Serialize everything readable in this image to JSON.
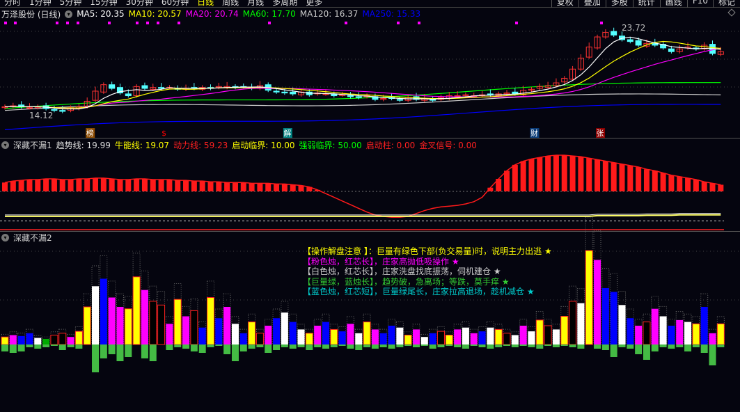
{
  "menu": {
    "tabs": [
      "分时",
      "1分钟",
      "5分钟",
      "15分钟",
      "30分钟",
      "60分钟",
      "日线",
      "周线",
      "月线",
      "多周期",
      "更多"
    ],
    "active": "日线",
    "right_buttons": [
      "复权",
      "叠加",
      "多股",
      "统计",
      "画线",
      "F10",
      "标记"
    ]
  },
  "main_header": {
    "stock": "万泽股份 (日线)",
    "ma": [
      {
        "label": "MA5: 20.35",
        "color": "#ffffff"
      },
      {
        "label": "MA10: 20.57",
        "color": "#ffff00"
      },
      {
        "label": "MA20: 20.74",
        "color": "#ff00ff"
      },
      {
        "label": "MA60: 17.70",
        "color": "#00ff00"
      },
      {
        "label": "MA120: 16.37",
        "color": "#cccccc"
      },
      {
        "label": "MA250: 15.33",
        "color": "#0000ff"
      }
    ]
  },
  "price_labels": {
    "high": "23.72",
    "low": "14.12"
  },
  "event_markers": [
    {
      "text": "榜",
      "index": 10,
      "color": "#8b4a00"
    },
    {
      "text": "$",
      "index": 19,
      "color": "#ff0000"
    },
    {
      "text": "解",
      "index": 34,
      "color": "#008080"
    },
    {
      "text": "财",
      "index": 64,
      "color": "#0a3c78"
    },
    {
      "text": "张",
      "index": 72,
      "color": "#8b0000"
    }
  ],
  "ind1_header": {
    "name": "深藏不漏1",
    "items": [
      {
        "label": "趋势线: 19.99",
        "color": "#dddddd"
      },
      {
        "label": "牛能线: 19.07",
        "color": "#ffff00"
      },
      {
        "label": "动力线: 59.23",
        "color": "#ff2020"
      },
      {
        "label": "启动临界: 10.00",
        "color": "#ffff00"
      },
      {
        "label": "强弱临界: 50.00",
        "color": "#00ff00"
      },
      {
        "label": "启动柱: 0.00",
        "color": "#ff2020"
      },
      {
        "label": "金叉信号: 0.00",
        "color": "#ff2020"
      }
    ]
  },
  "ind2_header": {
    "name": "深藏不漏2"
  },
  "legend": [
    {
      "text": "【操作解盘注意 】：巨量有绿色下部(负交易量)时，说明主力出逃 ★",
      "color": "#ffff00"
    },
    {
      "text": "【粉色烛，红芯长】，庄家高抛低吸操作 ★",
      "color": "#ff00ff"
    },
    {
      "text": "【白色烛，红芯长】，庄家洗盘找底振荡，伺机建仓 ★",
      "color": "#cccccc"
    },
    {
      "text": "【巨量绿，蓝烛长】，趋势破，急离场；等跌，莫手痒 ★",
      "color": "#33cc33"
    },
    {
      "text": "【蓝色烛，红芯短】，巨量绿尾长，庄家拉高退场，趁机减仓 ★",
      "color": "#00cccc"
    }
  ],
  "chart_data": {
    "type": "candlestick",
    "closes": [
      15.0,
      15.1,
      15.0,
      14.9,
      15.0,
      14.8,
      14.6,
      14.5,
      14.9,
      15.0,
      15.6,
      16.7,
      17.4,
      17.0,
      16.5,
      16.2,
      17.2,
      17.0,
      17.1,
      17.0,
      17.1,
      16.9,
      17.0,
      17.0,
      17.1,
      17.0,
      17.2,
      17.2,
      17.1,
      17.2,
      17.0,
      17.3,
      16.8,
      16.6,
      16.5,
      16.4,
      16.6,
      16.3,
      16.5,
      16.4,
      16.2,
      16.3,
      16.1,
      16.0,
      16.2,
      15.8,
      15.9,
      15.9,
      15.7,
      16.0,
      15.8,
      15.9,
      15.7,
      16.0,
      16.2,
      16.2,
      16.3,
      16.2,
      16.3,
      16.3,
      16.4,
      16.5,
      16.4,
      16.8,
      16.9,
      17.2,
      17.3,
      17.6,
      18.1,
      19.1,
      20.3,
      21.5,
      22.6,
      23.1,
      22.8,
      22.3,
      22.1,
      21.7,
      21.9,
      21.7,
      21.4,
      21.0,
      21.3,
      21.5,
      21.3,
      21.7,
      20.8,
      21.0
    ],
    "ma60_range": [
      14.8,
      17.7
    ],
    "ma120_range": [
      14.6,
      16.37
    ],
    "ma250_range": [
      12.5,
      15.33
    ],
    "price_range": [
      12.0,
      24.0
    ],
    "momentum": [
      62,
      64,
      65,
      66,
      66,
      67,
      67,
      66,
      66,
      67,
      67,
      68,
      68,
      67,
      66,
      66,
      67,
      67,
      66,
      66,
      66,
      65,
      65,
      64,
      64,
      63,
      63,
      62,
      62,
      62,
      61,
      61,
      61,
      60,
      60,
      59,
      58,
      56,
      52,
      47,
      42,
      37,
      32,
      27,
      22,
      18,
      16,
      15,
      15,
      16,
      20,
      24,
      27,
      29,
      30,
      31,
      33,
      36,
      42,
      55,
      67,
      78,
      86,
      91,
      94,
      96,
      98,
      99,
      99,
      98,
      97,
      95,
      93,
      91,
      89,
      87,
      85,
      83,
      80,
      78,
      75,
      72,
      70,
      68,
      66,
      63,
      61,
      59
    ],
    "trend_line": [
      18,
      18,
      18,
      18,
      18,
      18,
      18,
      18,
      18,
      18,
      18,
      18,
      18,
      18,
      18,
      18,
      18,
      18,
      18,
      18,
      18,
      18,
      18,
      18,
      18,
      18,
      18,
      18,
      18,
      18,
      18,
      18,
      18,
      18,
      18,
      18,
      18,
      18,
      18,
      18,
      18,
      18,
      18,
      18,
      18,
      18,
      18,
      18,
      18,
      18,
      18,
      18,
      18,
      18,
      18,
      18,
      18,
      18,
      18,
      18,
      18,
      18,
      18,
      18,
      18,
      18,
      18,
      18,
      18,
      18,
      18,
      18,
      19,
      19,
      19,
      19,
      19,
      19,
      19.5,
      19.5,
      19.5,
      19.5,
      20,
      20,
      20,
      20,
      20,
      19.99
    ],
    "volume": [
      8,
      10,
      9,
      12,
      7,
      6,
      10,
      12,
      8,
      14,
      40,
      62,
      70,
      50,
      40,
      38,
      72,
      58,
      46,
      42,
      22,
      48,
      30,
      36,
      18,
      50,
      28,
      40,
      22,
      12,
      24,
      12,
      20,
      28,
      34,
      24,
      16,
      12,
      20,
      24,
      16,
      14,
      22,
      12,
      24,
      16,
      12,
      20,
      18,
      10,
      16,
      8,
      12,
      14,
      10,
      16,
      18,
      12,
      14,
      18,
      16,
      12,
      10,
      20,
      14,
      26,
      20,
      16,
      30,
      46,
      44,
      100,
      90,
      60,
      56,
      42,
      28,
      20,
      24,
      38,
      30,
      20,
      26,
      24,
      22,
      40,
      12,
      22
    ],
    "volume_neg": [
      10,
      12,
      10,
      4,
      6,
      4,
      2,
      8,
      4,
      6,
      0,
      40,
      20,
      14,
      24,
      18,
      0,
      20,
      24,
      0,
      8,
      4,
      6,
      10,
      12,
      4,
      2,
      14,
      24,
      10,
      6,
      4,
      12,
      8,
      4,
      6,
      4,
      8,
      4,
      6,
      4,
      2,
      6,
      8,
      4,
      6,
      4,
      6,
      4,
      2,
      4,
      2,
      6,
      4,
      2,
      4,
      6,
      2,
      4,
      6,
      4,
      2,
      4,
      2,
      4,
      6,
      2,
      4,
      2,
      4,
      6,
      0,
      6,
      8,
      18,
      4,
      6,
      14,
      22,
      10,
      4,
      6,
      4,
      10,
      4,
      12,
      30,
      4
    ],
    "volume_type": [
      "Y",
      "M",
      "B",
      "B",
      "W",
      "G",
      "R",
      "R",
      "M",
      "Y",
      "Y",
      "W",
      "B",
      "M",
      "M",
      "Y",
      "Y",
      "M",
      "R",
      "R",
      "M",
      "Y",
      "M",
      "R",
      "B",
      "Y",
      "B",
      "M",
      "W",
      "B",
      "Y",
      "R",
      "M",
      "B",
      "W",
      "B",
      "W",
      "Y",
      "M",
      "B",
      "Y",
      "B",
      "M",
      "W",
      "Y",
      "M",
      "B",
      "B",
      "W",
      "Y",
      "M",
      "W",
      "B",
      "R",
      "Y",
      "M",
      "W",
      "M",
      "B",
      "W",
      "Y",
      "R",
      "W",
      "M",
      "W",
      "Y",
      "R",
      "W",
      "Y",
      "R",
      "W",
      "Y",
      "M",
      "B",
      "B",
      "W",
      "B",
      "M",
      "R",
      "M",
      "W",
      "B",
      "M",
      "W",
      "Y",
      "B",
      "M",
      "Y"
    ]
  },
  "colors": {
    "up": "#ff3232",
    "down": "#54ffff",
    "ma5": "#ffffff",
    "ma10": "#ffff00",
    "ma20": "#ff00ff",
    "ma60": "#00ff00",
    "ma120": "#cccccc",
    "ma250": "#0000ff"
  }
}
